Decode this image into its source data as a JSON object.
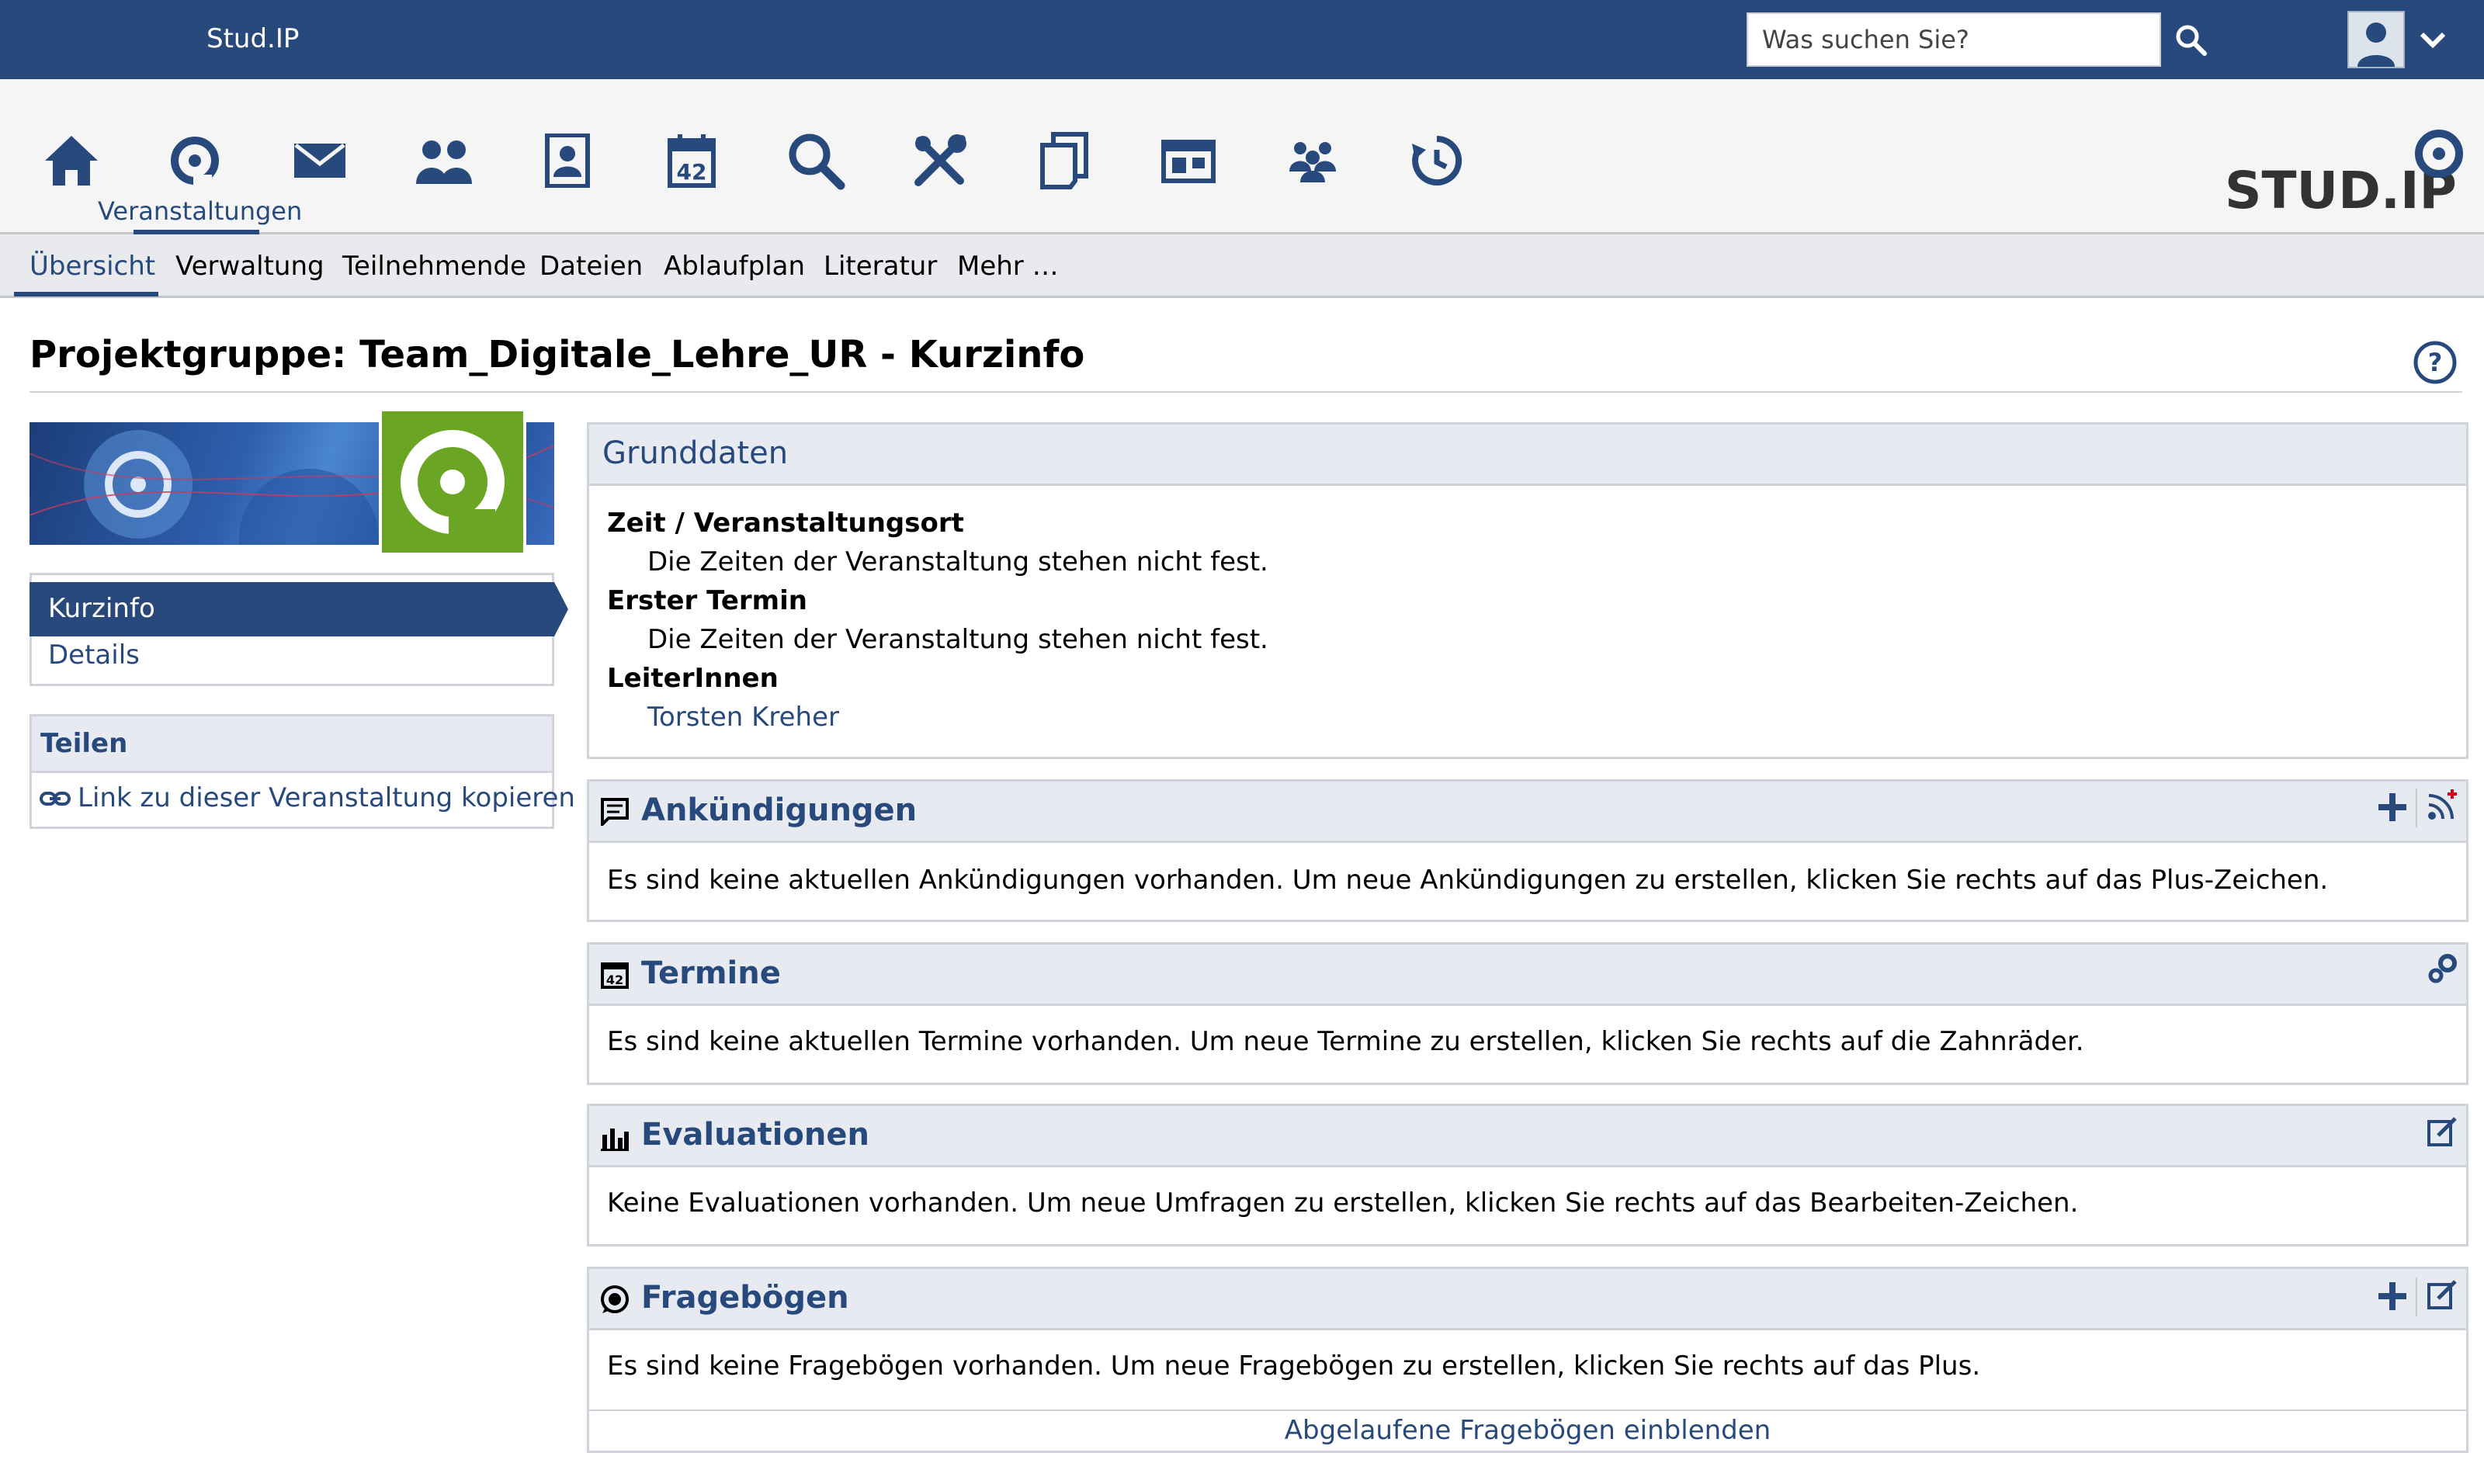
{
  "topbar": {
    "brand": "Stud.IP",
    "search_placeholder": "Was suchen Sie?",
    "icons": [
      "search-icon",
      "avatar-icon",
      "chevron-down-icon"
    ]
  },
  "navbar": {
    "items": [
      {
        "name": "home-icon"
      },
      {
        "name": "courses-icon",
        "label": "Veranstaltungen",
        "active": true
      },
      {
        "name": "mail-icon"
      },
      {
        "name": "community-icon"
      },
      {
        "name": "profile-icon"
      },
      {
        "name": "calendar-icon",
        "badge": "42"
      },
      {
        "name": "search-icon"
      },
      {
        "name": "tools-icon"
      },
      {
        "name": "files-icon"
      },
      {
        "name": "timetable-icon"
      },
      {
        "name": "groups-icon"
      },
      {
        "name": "history-icon"
      }
    ],
    "logo_text": "STUD.IP"
  },
  "subnav": {
    "tabs": [
      "Übersicht",
      "Verwaltung",
      "Teilnehmende",
      "Dateien",
      "Ablaufplan",
      "Literatur",
      "Mehr …"
    ],
    "active_index": 0
  },
  "page": {
    "title": "Projektgruppe: Team_Digitale_Lehre_UR - Kurzinfo"
  },
  "sidebar": {
    "nav": [
      "Kurzinfo",
      "Details"
    ],
    "share_title": "Teilen",
    "share_link": "Link zu dieser Veranstaltung kopieren"
  },
  "grunddaten": {
    "title": "Grunddaten",
    "rows": [
      {
        "label": "Zeit / Veranstaltungsort",
        "value": "Die Zeiten der Veranstaltung stehen nicht fest."
      },
      {
        "label": "Erster Termin",
        "value": "Die Zeiten der Veranstaltung stehen nicht fest."
      },
      {
        "label": "LeiterInnen",
        "value": "Torsten Kreher"
      }
    ]
  },
  "ankuendigungen": {
    "title": "Ankündigungen",
    "text": "Es sind keine aktuellen Ankündigungen vorhanden. Um neue Ankündigungen zu erstellen, klicken Sie rechts auf das Plus-Zeichen."
  },
  "termine": {
    "title": "Termine",
    "text": "Es sind keine aktuellen Termine vorhanden. Um neue Termine zu erstellen, klicken Sie rechts auf die Zahnräder."
  },
  "evaluationen": {
    "title": "Evaluationen",
    "text": "Keine Evaluationen vorhanden. Um neue Umfragen zu erstellen, klicken Sie rechts auf das Bearbeiten-Zeichen."
  },
  "frageboegen": {
    "title": "Fragebögen",
    "text": "Es sind keine Fragebögen vorhanden. Um neue Fragebögen zu erstellen, klicken Sie rechts auf das Plus.",
    "footer_link": "Abgelaufene Fragebögen einblenden"
  },
  "colors": {
    "brand_blue": "#28497c",
    "box_header": "#e7ebf1",
    "nav_bg": "#f5f5f5",
    "subnav_bg": "#e8eaee",
    "green": "#6aa623"
  }
}
